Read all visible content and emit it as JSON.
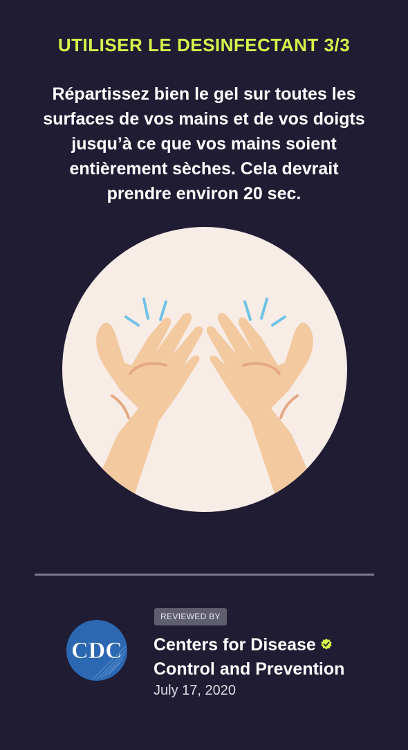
{
  "step": {
    "title": "UTILISER LE DESINFECTANT 3/3"
  },
  "instructions": {
    "text": "Répartissez bien le gel sur toutes les surfaces de vos mains et de vos doigts jusqu’à ce que vos mains soient entièrement sèches. Cela devrait prendre environ 20 sec."
  },
  "illustration": {
    "icon": "hands-rubbing-sanitizer-icon",
    "circle_color": "#f8ece6",
    "skin_color": "#f3c9a0",
    "motion_color": "#6ec3e4"
  },
  "review": {
    "badge_label": "REVIEWED BY",
    "logo_text": "CDC",
    "org_line1": "Centers for Disease",
    "org_line2": "Control and Prevention",
    "date": "July 17, 2020",
    "verified_color": "#d6f54c"
  },
  "colors": {
    "background": "#1f1c33",
    "accent": "#d6f54c",
    "cdc_blue": "#2c68b1"
  }
}
